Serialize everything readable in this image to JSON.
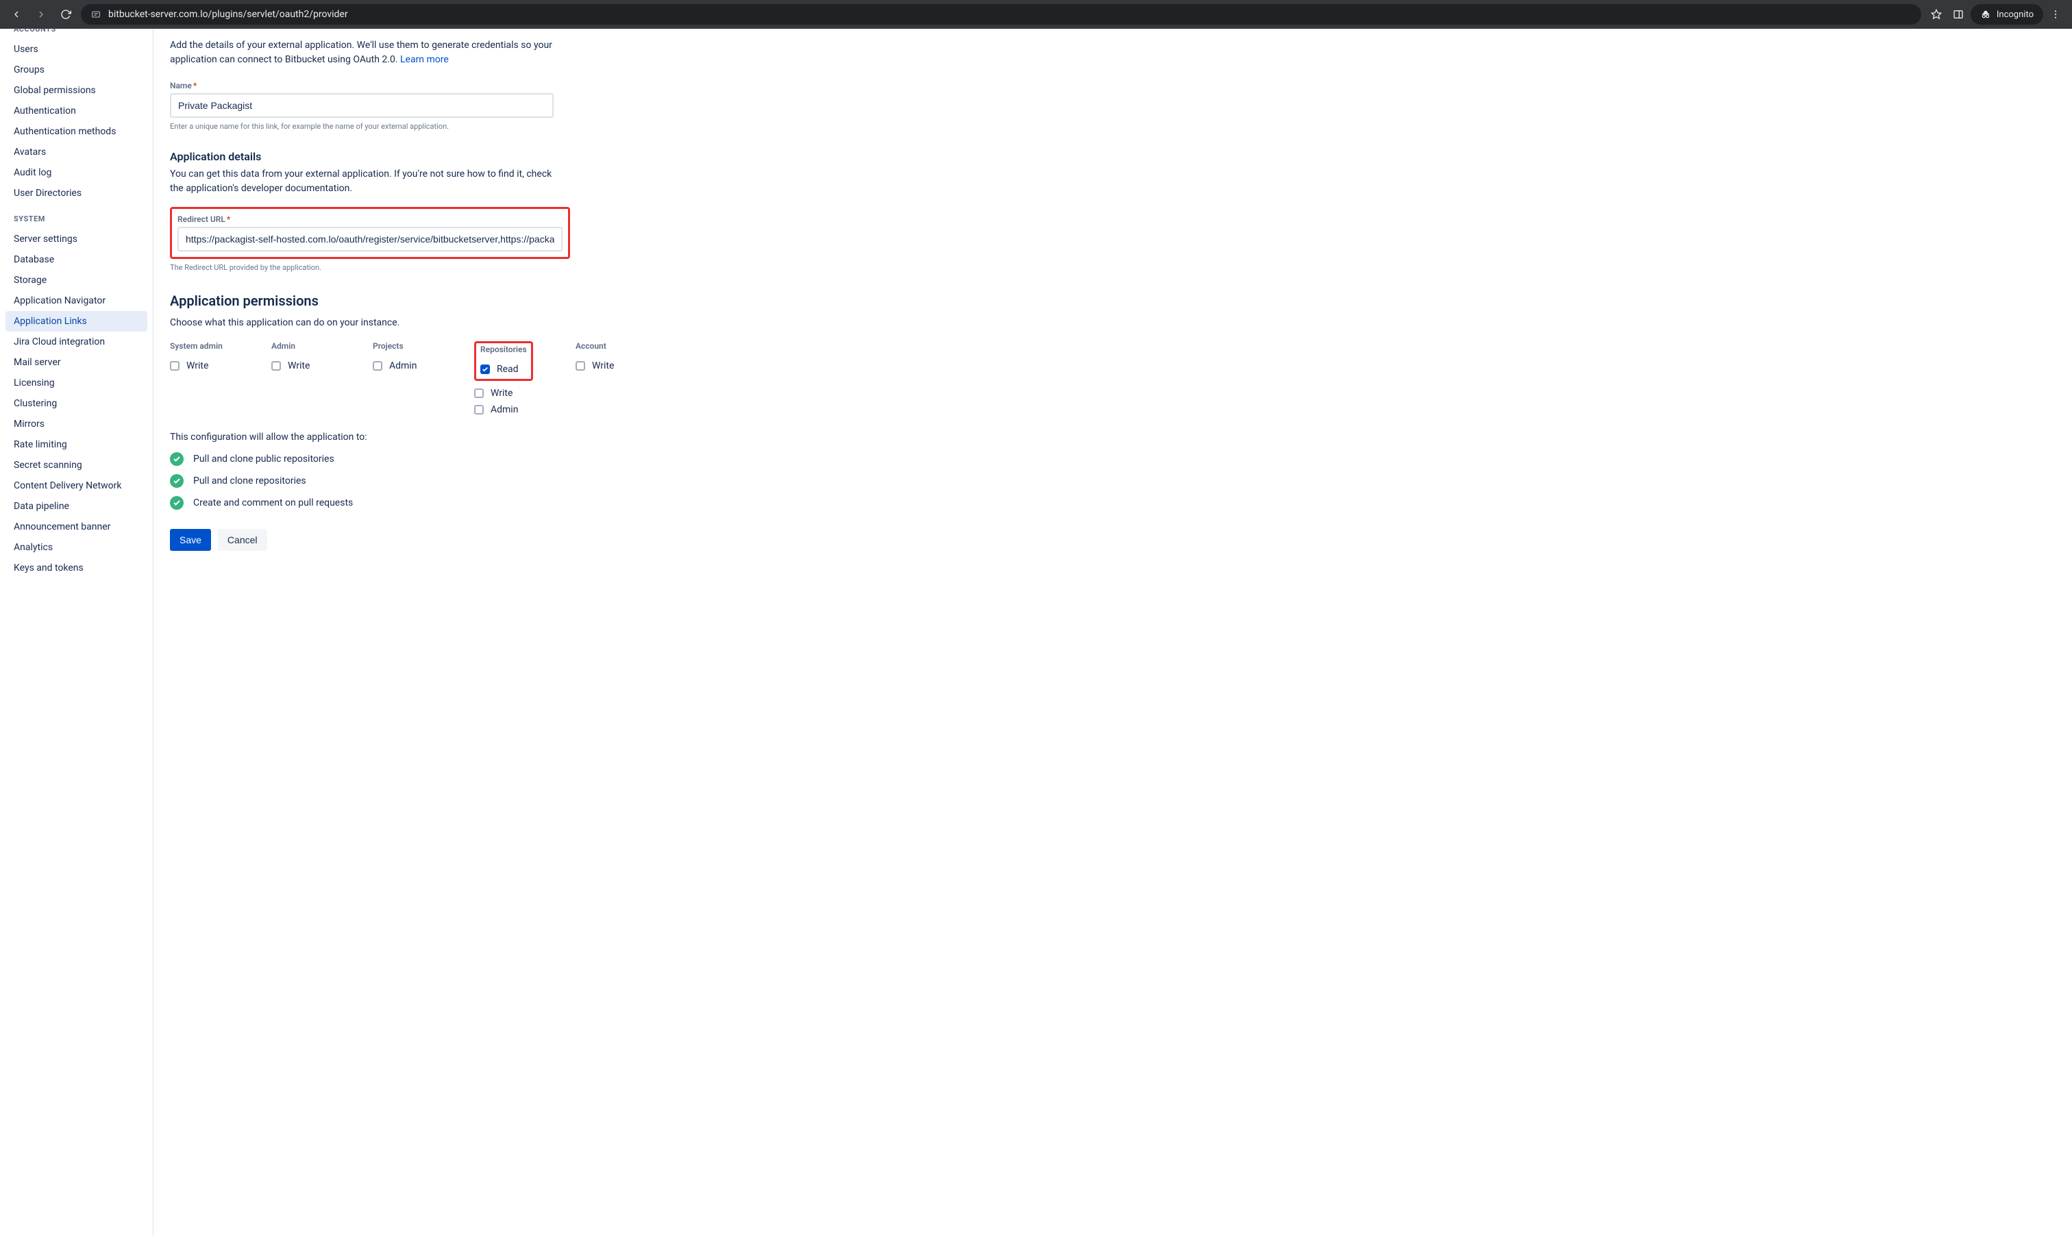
{
  "browser": {
    "url": "bitbucket-server.com.lo/plugins/servlet/oauth2/provider",
    "incognito_label": "Incognito"
  },
  "sidebar": {
    "section_accounts": "ACCOUNTS",
    "accounts": [
      "Users",
      "Groups",
      "Global permissions",
      "Authentication",
      "Authentication methods",
      "Avatars",
      "Audit log",
      "User Directories"
    ],
    "section_system": "SYSTEM",
    "system": [
      "Server settings",
      "Database",
      "Storage",
      "Application Navigator",
      "Application Links",
      "Jira Cloud integration",
      "Mail server",
      "Licensing",
      "Clustering",
      "Mirrors",
      "Rate limiting",
      "Secret scanning",
      "Content Delivery Network",
      "Data pipeline",
      "Announcement banner",
      "Analytics",
      "Keys and tokens"
    ],
    "selected_system_index": 4
  },
  "form": {
    "intro_text": "Add the details of your external application. We'll use them to generate credentials so your application can connect to Bitbucket using OAuth 2.0. ",
    "learn_more": "Learn more",
    "name_label": "Name",
    "name_value": "Private Packagist",
    "name_helper": "Enter a unique name for this link, for example the name of your external application.",
    "app_details_heading": "Application details",
    "app_details_desc": "You can get this data from your external application. If you're not sure how to find it, check the application's developer documentation.",
    "redirect_label": "Redirect URL",
    "redirect_value": "https://packagist-self-hosted.com.lo/oauth/register/service/bitbucketserver,https://packagi",
    "redirect_helper": "The Redirect URL provided by the application.",
    "permissions_heading": "Application permissions",
    "permissions_desc": "Choose what this application can do on your instance.",
    "perm_groups": [
      {
        "title": "System admin",
        "options": [
          {
            "label": "Write",
            "checked": false
          }
        ]
      },
      {
        "title": "Admin",
        "options": [
          {
            "label": "Write",
            "checked": false
          }
        ]
      },
      {
        "title": "Projects",
        "options": [
          {
            "label": "Admin",
            "checked": false
          }
        ]
      },
      {
        "title": "Repositories",
        "options": [
          {
            "label": "Read",
            "checked": true
          },
          {
            "label": "Write",
            "checked": false
          },
          {
            "label": "Admin",
            "checked": false
          }
        ],
        "highlight_option": 0
      },
      {
        "title": "Account",
        "options": [
          {
            "label": "Write",
            "checked": false
          }
        ]
      }
    ],
    "allow_title": "This configuration will allow the application to:",
    "allow_items": [
      "Pull and clone public repositories",
      "Pull and clone repositories",
      "Create and comment on pull requests"
    ],
    "save_label": "Save",
    "cancel_label": "Cancel"
  }
}
